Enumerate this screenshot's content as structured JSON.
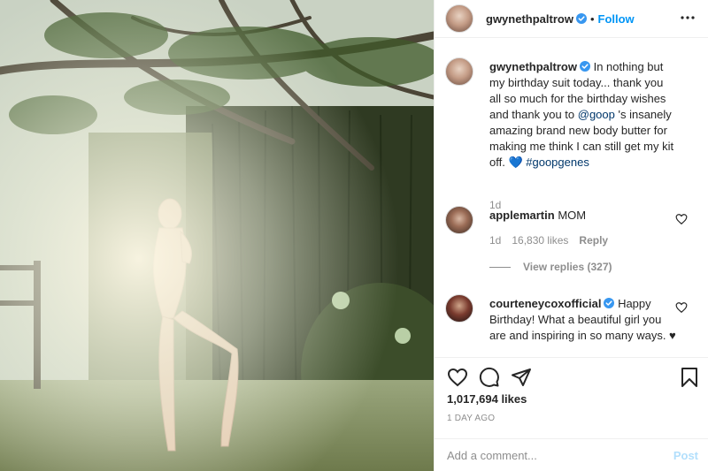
{
  "post": {
    "username": "gwynethpaltrow",
    "verified": true,
    "follow_label": "Follow",
    "separator": "•",
    "more_icon": "more-options-icon",
    "caption": {
      "before_link": "In nothing but my birthday suit today... thank you all so much for the birthday wishes and thank you to ",
      "link": "@goop",
      "after_link": " 's insanely amazing brand new body butter for making me think I can still get my kit off. ",
      "emoji": "💙",
      "hashtag": "#goopgenes",
      "age": "1d"
    }
  },
  "comments": [
    {
      "username": "applemartin",
      "verified": false,
      "text": "MOM",
      "age": "1d",
      "likes": "16,830 likes",
      "reply_label": "Reply",
      "view_replies": "View replies (327)"
    },
    {
      "username": "courteneycoxofficial",
      "verified": true,
      "text": "Happy Birthday! What a beautiful girl you are and inspiring in so many ways. ♥"
    }
  ],
  "stats": {
    "likes": "1,017,694 likes",
    "time_ago": "1 DAY AGO"
  },
  "add_comment": {
    "placeholder": "Add a comment...",
    "post_label": "Post"
  },
  "colors": {
    "accent": "#0095f6",
    "link": "#00376b",
    "muted": "#8e8e8e"
  }
}
